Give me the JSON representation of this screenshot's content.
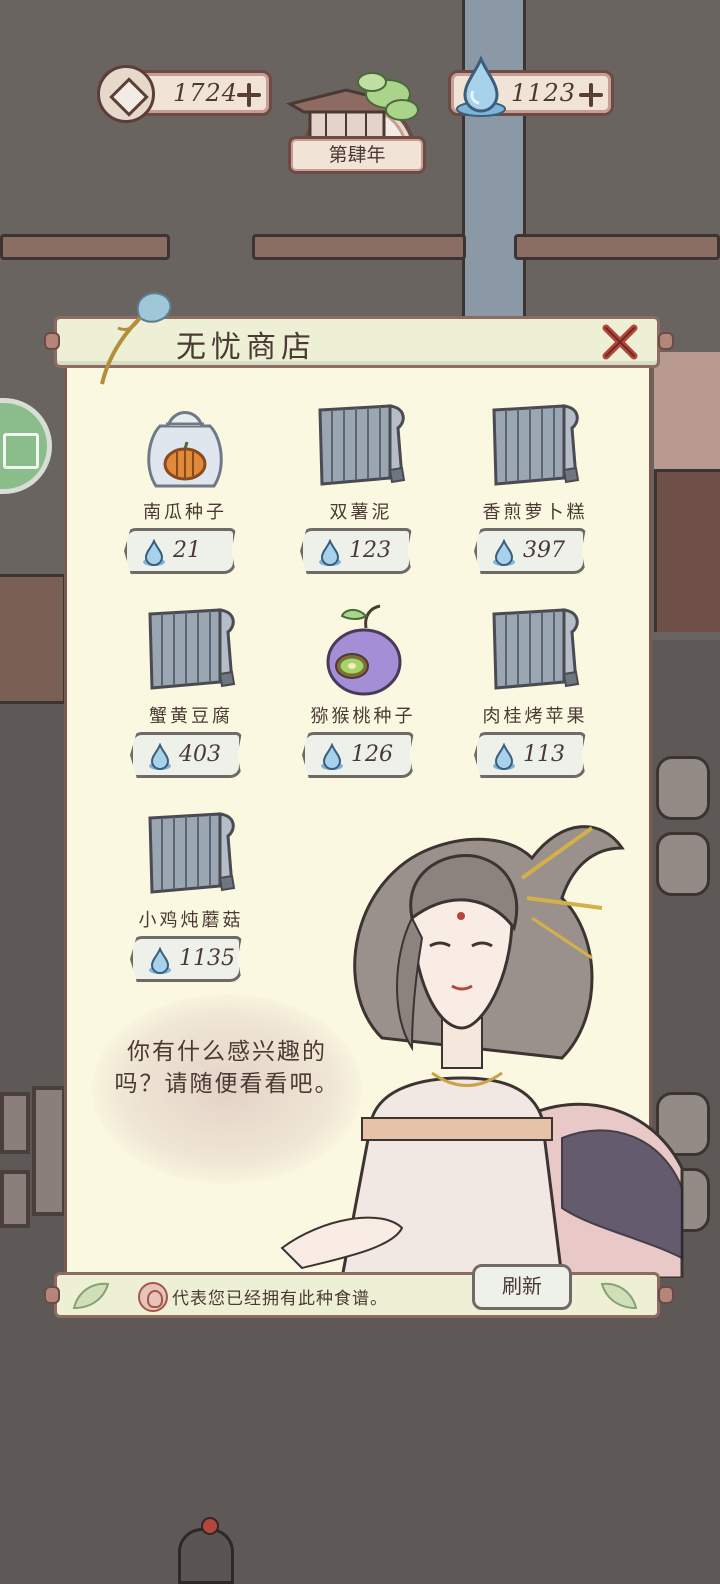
{
  "hud": {
    "coins": "1724",
    "gems": "1123",
    "year_label": "第肆年"
  },
  "shop": {
    "title": "无忧商店",
    "items": [
      {
        "name": "南瓜种子",
        "price": "21",
        "icon": "pumpkin-seed-bag-icon"
      },
      {
        "name": "双薯泥",
        "price": "123",
        "icon": "recipe-scroll-icon"
      },
      {
        "name": "香煎萝卜糕",
        "price": "397",
        "icon": "recipe-scroll-icon"
      },
      {
        "name": "蟹黄豆腐",
        "price": "403",
        "icon": "recipe-scroll-icon"
      },
      {
        "name": "猕猴桃种子",
        "price": "126",
        "icon": "kiwi-seed-icon"
      },
      {
        "name": "肉桂烤苹果",
        "price": "113",
        "icon": "recipe-scroll-icon"
      },
      {
        "name": "小鸡炖蘑菇",
        "price": "1135",
        "icon": "recipe-scroll-icon"
      }
    ],
    "dialogue": "你有什么感兴趣的吗？请随便看看吧。",
    "footer_note": "代表您已经拥有此种食谱。",
    "refresh_label": "刷新"
  },
  "colors": {
    "panel_bg": "#fbf8e1",
    "panel_border": "#8b6b62",
    "close_red": "#b5463b",
    "gem_blue": "#7fb4d8"
  }
}
